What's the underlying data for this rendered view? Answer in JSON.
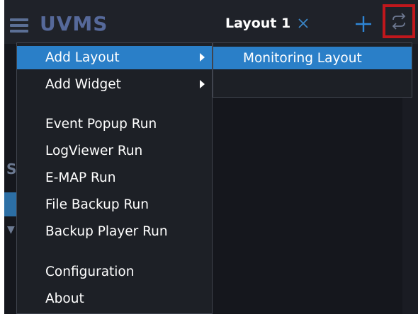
{
  "app": {
    "title": "UVMS",
    "brand_color": "#56699a"
  },
  "tabs": [
    {
      "label": "Layout 1"
    }
  ],
  "toolbar": {
    "close_tab_icon": "close-icon",
    "add_tab_icon": "plus-icon",
    "refresh_icon": "refresh-icon"
  },
  "menu": {
    "items": [
      {
        "label": "Add Layout",
        "has_submenu": true
      },
      {
        "label": "Add Widget",
        "has_submenu": true
      },
      {
        "label": "Event Popup Run"
      },
      {
        "label": "LogViewer Run"
      },
      {
        "label": "E-MAP Run"
      },
      {
        "label": "File Backup Run"
      },
      {
        "label": "Backup Player Run"
      },
      {
        "label": "Configuration"
      },
      {
        "label": "About"
      }
    ]
  },
  "submenu": {
    "items": [
      {
        "label": "Monitoring Layout"
      }
    ]
  },
  "colors": {
    "highlight": "#2a7fc8",
    "highlight_box": "#c0171c",
    "menu_bg": "#1d2026"
  }
}
